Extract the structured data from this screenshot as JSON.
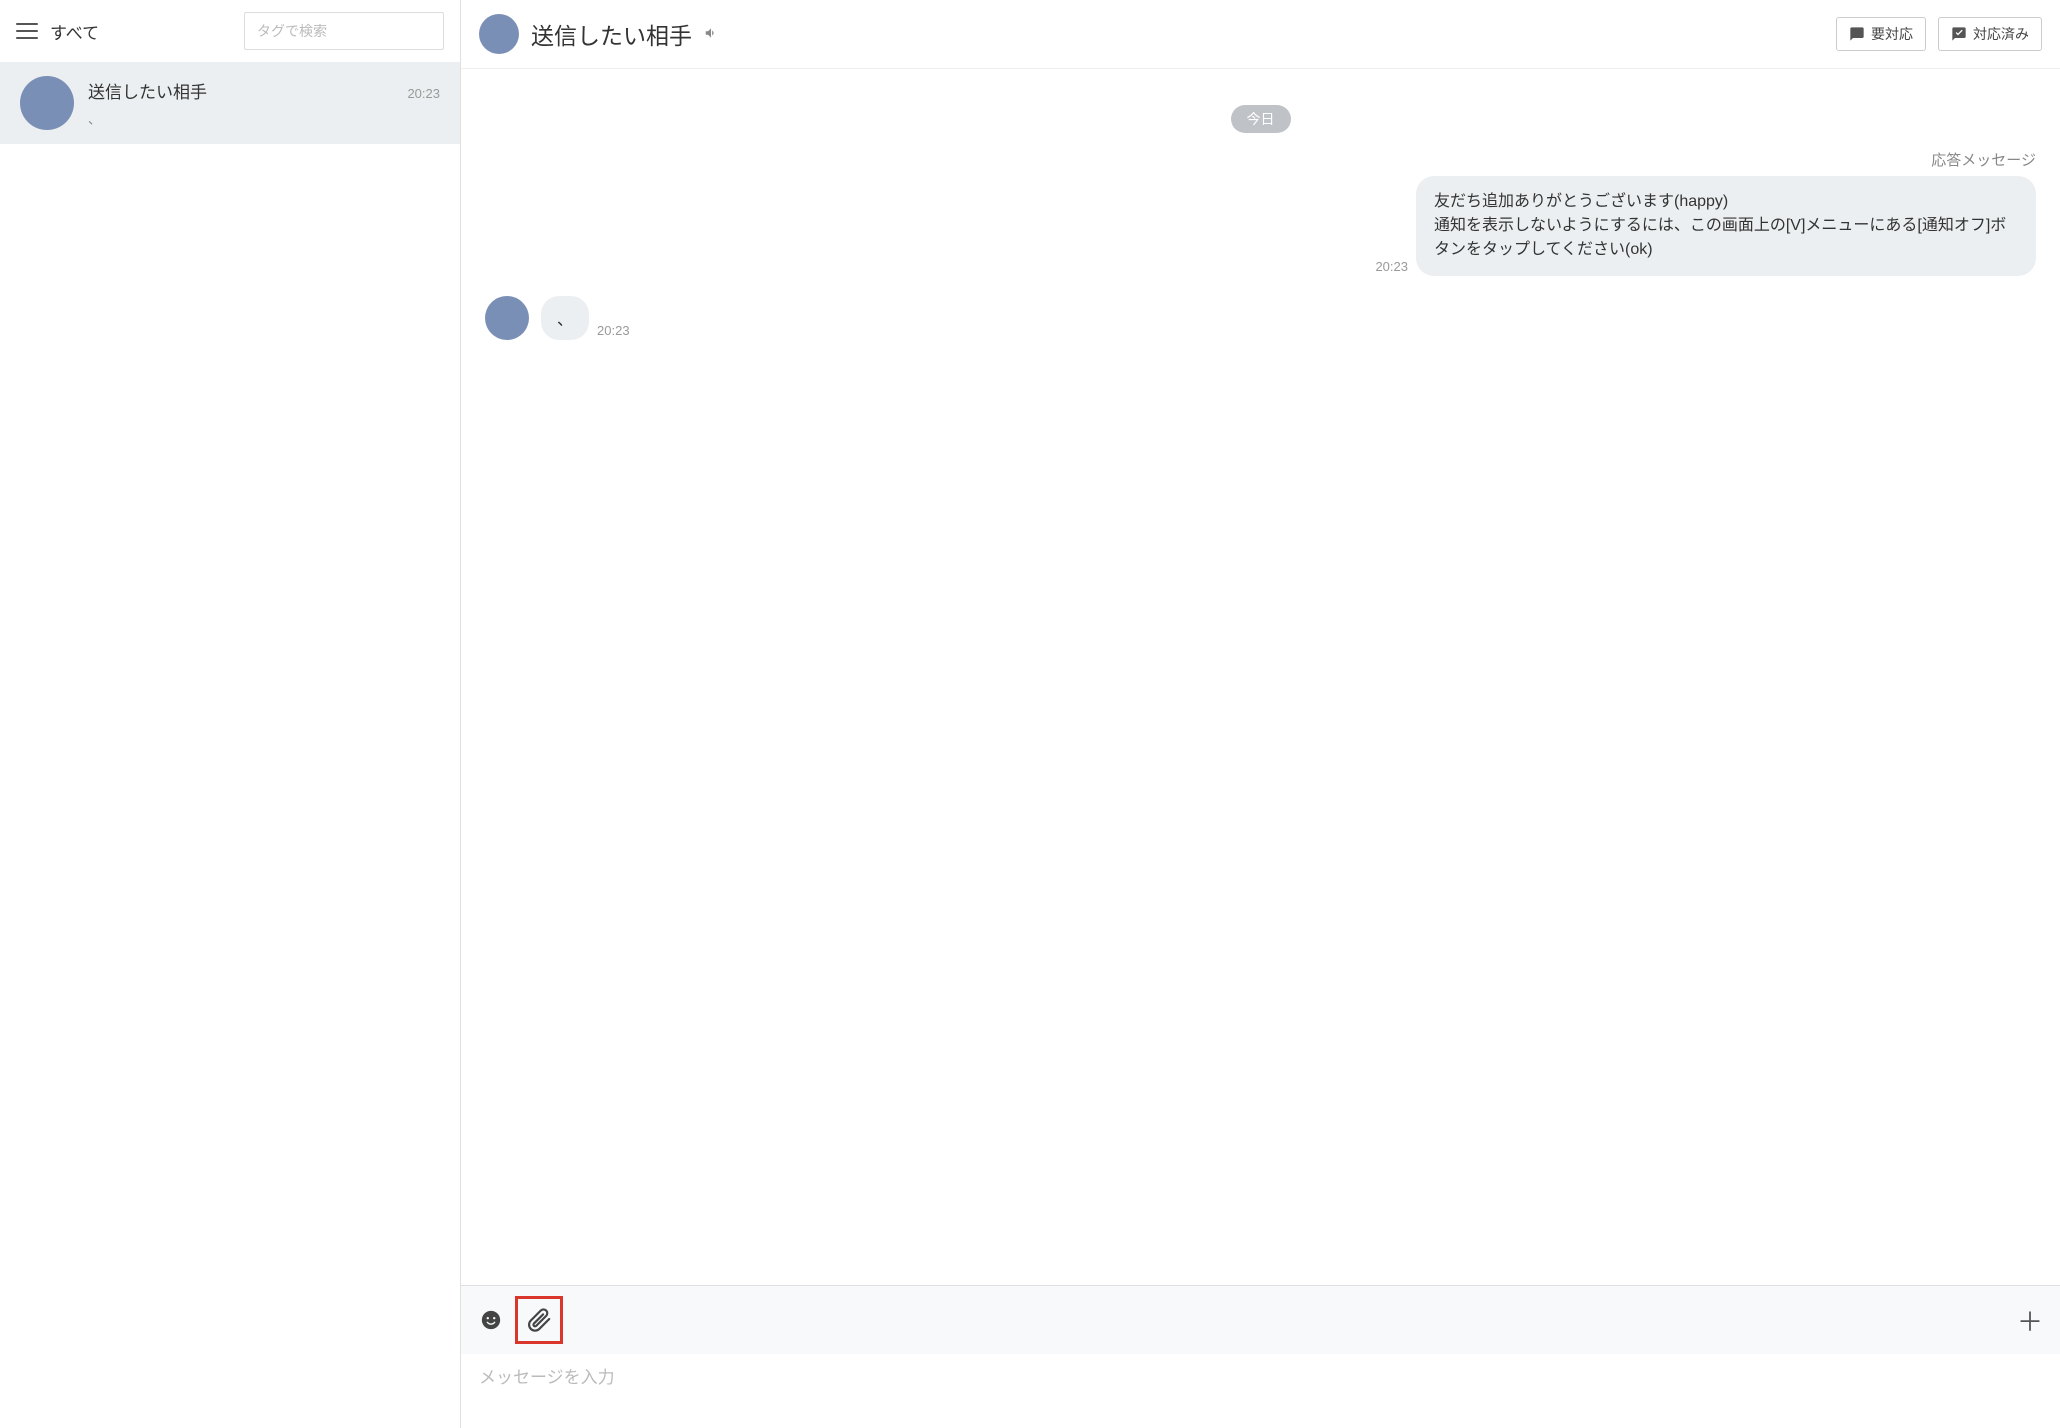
{
  "sidebar": {
    "title": "すべて",
    "search_placeholder": "タグで検索",
    "conversations": [
      {
        "name": "送信したい相手",
        "time": "20:23",
        "preview": "、"
      }
    ]
  },
  "header": {
    "title": "送信したい相手",
    "btn_need": "要対応",
    "btn_done": "対応済み"
  },
  "chat": {
    "date_label": "今日",
    "auto_reply_label": "応答メッセージ",
    "messages": [
      {
        "side": "right",
        "time": "20:23",
        "text": "友だち追加ありがとうございます(happy)\n通知を表示しないようにするには、この画面上の[V]メニューにある[通知オフ]ボタンをタップしてください(ok)"
      },
      {
        "side": "left",
        "time": "20:23",
        "text": "、"
      }
    ]
  },
  "input": {
    "placeholder": "メッセージを入力"
  }
}
